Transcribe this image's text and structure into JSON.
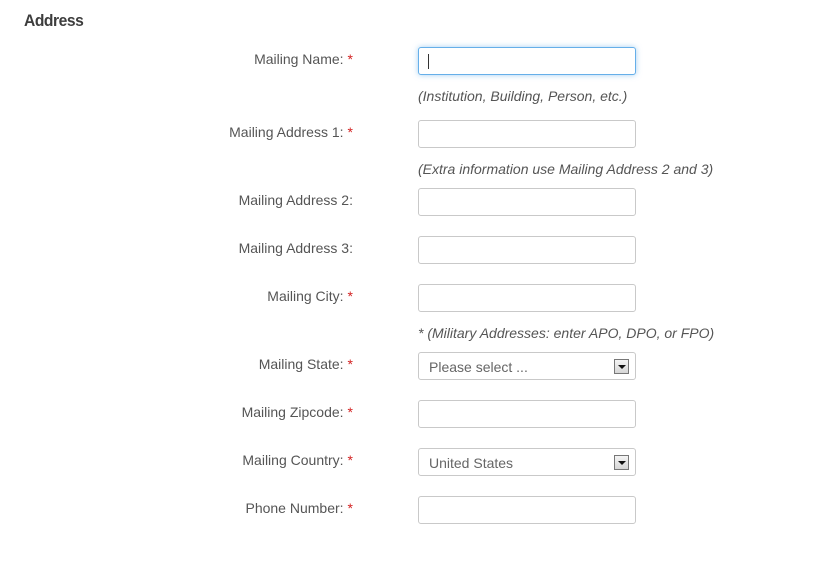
{
  "section": {
    "title": "Address"
  },
  "required_marker": "*",
  "fields": {
    "mailing_name": {
      "label": "Mailing Name:",
      "value": "",
      "hint": "(Institution, Building, Person, etc.)"
    },
    "mailing_address_1": {
      "label": "Mailing Address 1:",
      "value": "",
      "hint": "(Extra information use Mailing Address 2 and 3)"
    },
    "mailing_address_2": {
      "label": "Mailing Address 2:",
      "value": ""
    },
    "mailing_address_3": {
      "label": "Mailing Address 3:",
      "value": ""
    },
    "mailing_city": {
      "label": "Mailing City:",
      "value": "",
      "hint": "* (Military Addresses: enter APO, DPO, or FPO)"
    },
    "mailing_state": {
      "label": "Mailing State:",
      "selected": "Please select ..."
    },
    "mailing_zipcode": {
      "label": "Mailing Zipcode:",
      "value": ""
    },
    "mailing_country": {
      "label": "Mailing Country:",
      "selected": "United States"
    },
    "phone_number": {
      "label": "Phone Number:",
      "value": ""
    }
  }
}
